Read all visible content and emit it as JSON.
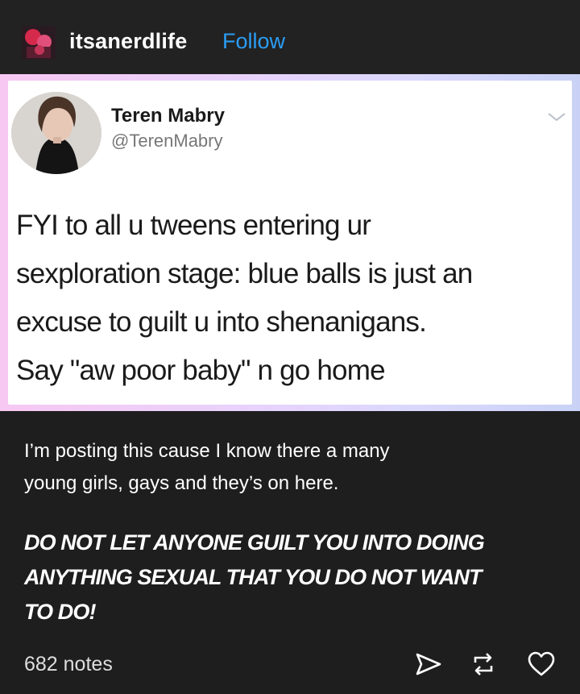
{
  "header": {
    "blog_name": "itsanerdlife",
    "follow_label": "Follow"
  },
  "tweet": {
    "display_name": "Teren Mabry",
    "handle": "@TerenMabry",
    "lines": [
      "FYI to all u tweens entering ur",
      "sexploration stage: blue balls is just an",
      "excuse to guilt u into shenanigans.",
      "Say \"aw poor baby\" n go home"
    ]
  },
  "post": {
    "caption_lines": [
      "I’m posting this cause I know there a many",
      "young girls, gays and they’s on here."
    ],
    "emphasis_lines": [
      "DO NOT LET ANYONE GUILT YOU INTO DOING",
      "ANYTHING SEXUAL THAT YOU DO NOT WANT",
      "TO DO!"
    ]
  },
  "footer": {
    "notes_label": "682 notes",
    "icons": [
      "share-icon",
      "reblog-icon",
      "heart-icon"
    ]
  },
  "colors": {
    "background": "#1e1e1e",
    "follow_accent": "#2a9df4",
    "frame_gradient": [
      "#f7c8f2",
      "#c9d2f6"
    ]
  }
}
